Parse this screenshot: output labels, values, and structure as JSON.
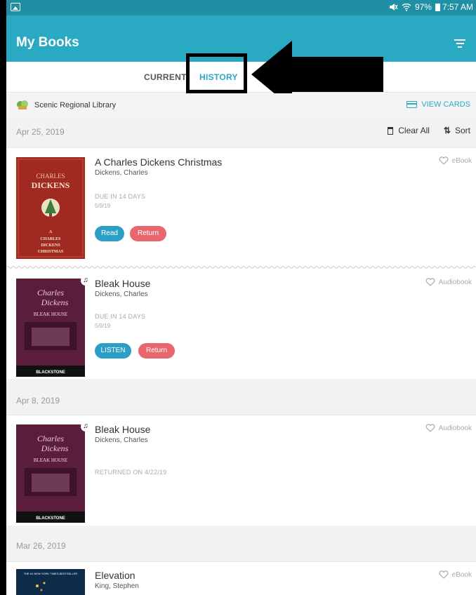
{
  "status_bar": {
    "battery": "97%",
    "time": "7:57 AM"
  },
  "app_bar": {
    "title": "My Books"
  },
  "tabs": {
    "current": "CURRENT",
    "history": "HISTORY"
  },
  "library": {
    "name": "Scenic Regional Library",
    "view_cards": "VIEW CARDS"
  },
  "groups": [
    {
      "date": "Apr 25, 2019",
      "clear_all": "Clear All",
      "sort": "Sort"
    },
    {
      "date": "Apr 8, 2019"
    },
    {
      "date": "Mar 26, 2019"
    }
  ],
  "books": [
    {
      "title": "A Charles Dickens Christmas",
      "author": "Dickens, Charles",
      "format": "eBook",
      "due": "DUE IN 14 DAYS",
      "due_date": "5/9/19",
      "action": "Read",
      "return": "Return",
      "cover_text": [
        "CHARLES",
        "DICKENS",
        "A",
        "CHARLES",
        "DICKENS",
        "CHRISTMAS"
      ]
    },
    {
      "title": "Bleak House",
      "author": "Dickens, Charles",
      "format": "Audiobook",
      "due": "DUE IN 14 DAYS",
      "due_date": "5/9/19",
      "action": "LISTEN",
      "return": "Return",
      "cover_text": [
        "Charles",
        "Dickens",
        "BLEAK HOUSE",
        "BLACKSTONE"
      ]
    },
    {
      "title": "Bleak House",
      "author": "Dickens, Charles",
      "format": "Audiobook",
      "returned": "RETURNED ON 4/22/19",
      "cover_text": [
        "Charles",
        "Dickens",
        "BLEAK HOUSE",
        "BLACKSTONE"
      ]
    },
    {
      "title": "Elevation",
      "author": "King, Stephen",
      "format": "eBook",
      "cover_text": [
        "THE #1 NEW YORK TIMES BESTSELLER"
      ]
    }
  ],
  "colors": {
    "status_bar": "#1f8fa5",
    "app_bar": "#2aa9c2",
    "accent": "#2aa9c2",
    "button_blue": "#2b9fc5",
    "button_red": "#e8676e"
  },
  "icons": {
    "gallery": "gallery-icon",
    "filter": "filter-icon",
    "card": "card-icon",
    "trash": "trash-icon",
    "sort": "sort-icon",
    "heart": "heart-icon",
    "headphones": "headphones-icon"
  }
}
